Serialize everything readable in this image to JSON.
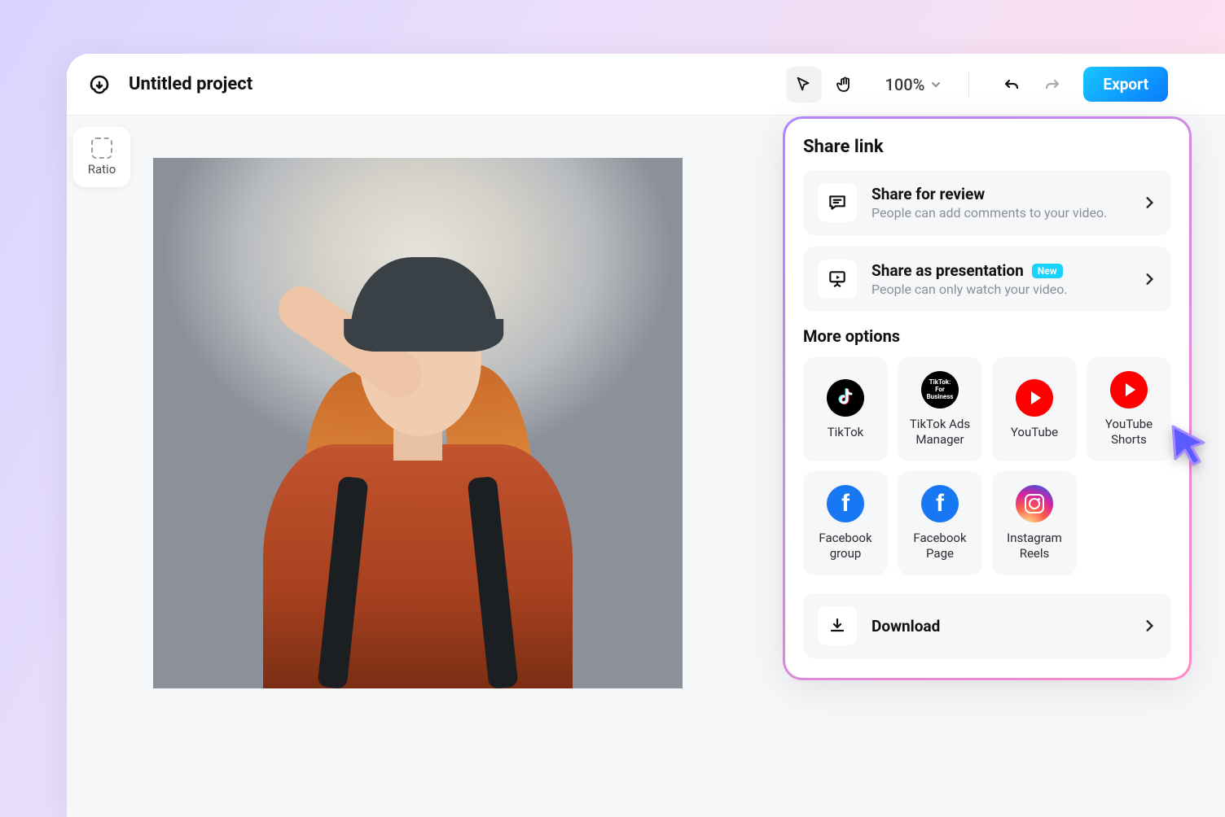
{
  "topbar": {
    "project_title": "Untitled project",
    "zoom_label": "100%",
    "export_label": "Export"
  },
  "sidebar": {
    "ratio_label": "Ratio"
  },
  "share_panel": {
    "title": "Share link",
    "review": {
      "title": "Share for review",
      "subtitle": "People can add comments to your video."
    },
    "presentation": {
      "title": "Share as presentation",
      "badge": "New",
      "subtitle": "People can only watch your video."
    },
    "more_options_title": "More options",
    "options": [
      {
        "key": "tiktok",
        "label": "TikTok"
      },
      {
        "key": "tiktok_ads",
        "label": "TikTok Ads Manager"
      },
      {
        "key": "youtube",
        "label": "YouTube"
      },
      {
        "key": "youtube_shorts",
        "label": "YouTube Shorts"
      },
      {
        "key": "facebook_group",
        "label": "Facebook group"
      },
      {
        "key": "facebook_page",
        "label": "Facebook Page"
      },
      {
        "key": "instagram_reels",
        "label": "Instagram Reels"
      }
    ],
    "download_label": "Download"
  }
}
